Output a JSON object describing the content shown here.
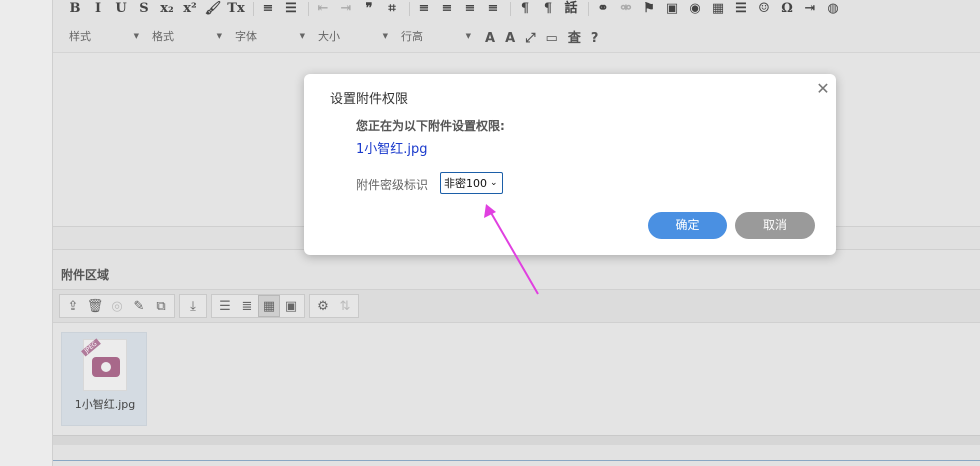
{
  "toolbar": {
    "row1": [
      {
        "name": "bold-icon",
        "glyph": "B"
      },
      {
        "name": "italic-icon",
        "glyph": "I"
      },
      {
        "name": "underline-icon",
        "glyph": "U"
      },
      {
        "name": "strikethrough-icon",
        "glyph": "S"
      },
      {
        "name": "subscript-icon",
        "glyph": "x₂"
      },
      {
        "name": "superscript-icon",
        "glyph": "x²"
      },
      {
        "name": "format-painter-icon",
        "glyph": "🖌"
      },
      {
        "name": "clear-format-icon",
        "glyph": "Tx"
      },
      {
        "name": "numbered-list-icon",
        "glyph": "≡"
      },
      {
        "name": "bullet-list-icon",
        "glyph": "☰"
      },
      {
        "name": "outdent-icon",
        "glyph": "⇤"
      },
      {
        "name": "indent-icon",
        "glyph": "⇥"
      },
      {
        "name": "blockquote-icon",
        "glyph": "❞"
      },
      {
        "name": "code-block-icon",
        "glyph": "⌗"
      },
      {
        "name": "align-left-icon",
        "glyph": "≡"
      },
      {
        "name": "align-center-icon",
        "glyph": "≡"
      },
      {
        "name": "align-right-icon",
        "glyph": "≡"
      },
      {
        "name": "align-justify-icon",
        "glyph": "≡"
      },
      {
        "name": "ltr-icon",
        "glyph": "¶"
      },
      {
        "name": "rtl-icon",
        "glyph": "¶"
      },
      {
        "name": "language-icon",
        "glyph": "話"
      },
      {
        "name": "link-icon",
        "glyph": "⚭"
      },
      {
        "name": "unlink-icon",
        "glyph": "⚮"
      },
      {
        "name": "anchor-flag-icon",
        "glyph": "⚑"
      },
      {
        "name": "image-icon",
        "glyph": "▣"
      },
      {
        "name": "flash-icon",
        "glyph": "◉"
      },
      {
        "name": "table-icon",
        "glyph": "▦"
      },
      {
        "name": "horizontal-line-icon",
        "glyph": "☰"
      },
      {
        "name": "smiley-icon",
        "glyph": "☺"
      },
      {
        "name": "special-char-icon",
        "glyph": "Ω"
      },
      {
        "name": "page-break-icon",
        "glyph": "⇥"
      },
      {
        "name": "iframe-icon",
        "glyph": "◍"
      }
    ],
    "combos": {
      "style": "样式",
      "format": "格式",
      "font": "字体",
      "size": "大小",
      "line_height": "行高"
    },
    "row2_icons": [
      {
        "name": "text-color-icon",
        "glyph": "A"
      },
      {
        "name": "bg-color-icon",
        "glyph": "A"
      },
      {
        "name": "maximize-icon",
        "glyph": "⤢"
      },
      {
        "name": "show-blocks-icon",
        "glyph": "▭"
      },
      {
        "name": "source-icon",
        "glyph": "査"
      },
      {
        "name": "help-icon",
        "glyph": "?"
      }
    ]
  },
  "attachments": {
    "title": "附件区域",
    "files": [
      {
        "name": "1小智红.jpg",
        "badge": "JPEG"
      }
    ]
  },
  "dialog": {
    "title": "设置附件权限",
    "subtitle": "您正在为以下附件设置权限:",
    "filename": "1小智红.jpg",
    "label": "附件密级标识",
    "select_value": "非密100",
    "ok": "确定",
    "cancel": "取消"
  },
  "colors": {
    "accent": "#4a90e2",
    "cancel": "#9a9a9a",
    "link": "#1a3acc",
    "arrow": "#e040e0"
  }
}
